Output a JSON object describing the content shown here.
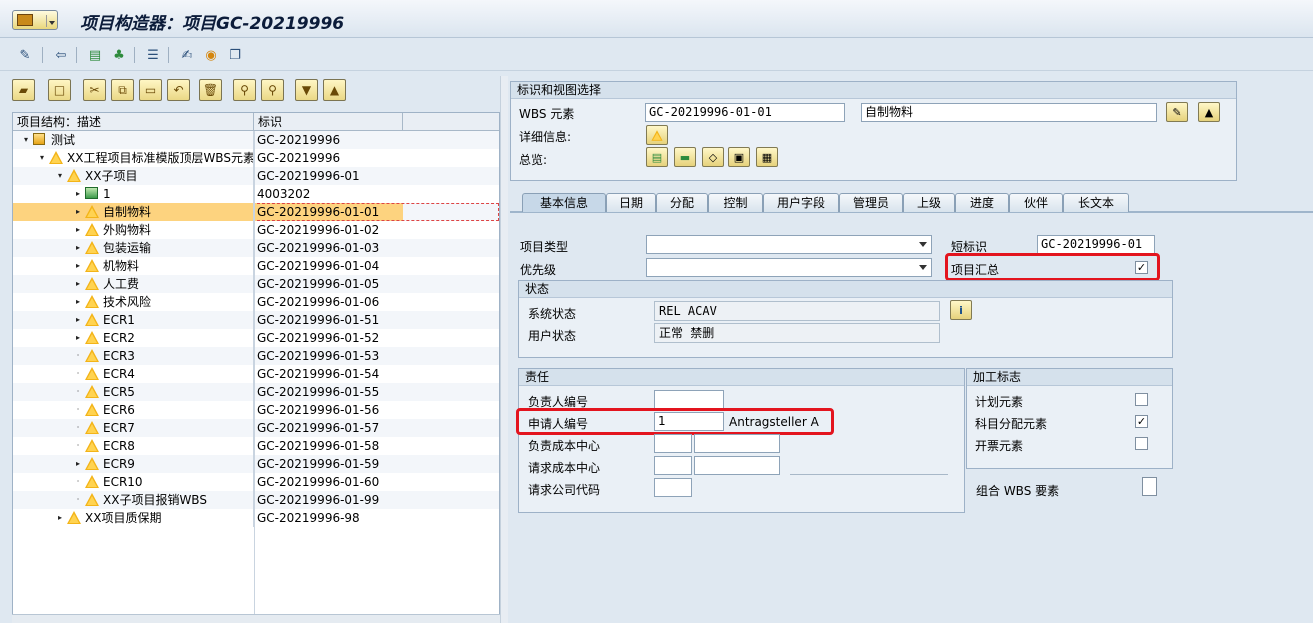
{
  "window": {
    "title": "项目构造器：项目GC-20219996"
  },
  "app_toolbar": {
    "icons": [
      "pencil-glasses-icon",
      "back-nav-icon",
      "green-hierarchy-icon",
      "orange-hierarchy-icon",
      "list-icon",
      "edit-icon",
      "coin-icon",
      "document-settings-icon"
    ]
  },
  "tree_toolbar": {
    "icons": [
      "open-folder-icon",
      "new-doc-icon",
      "cut-icon",
      "copy-icon",
      "paste-icon",
      "undo-icon",
      "delete-icon",
      "find-icon",
      "find-next-icon",
      "expand-icon",
      "collapse-icon"
    ]
  },
  "tree": {
    "headers": {
      "desc": "项目结构：描述",
      "id": "标识"
    },
    "rows": [
      {
        "level": 0,
        "exp": "▾",
        "icon": "project",
        "label": "测试",
        "id": "GC-20219996"
      },
      {
        "level": 1,
        "exp": "▾",
        "icon": "wbs",
        "label": "XX工程项目标准模版顶层WBS元素",
        "id": "GC-20219996"
      },
      {
        "level": 2,
        "exp": "▾",
        "icon": "wbs",
        "label": "XX子项目",
        "id": "GC-20219996-01"
      },
      {
        "level": 3,
        "exp": "▸",
        "icon": "network",
        "label": "1",
        "id": "4003202"
      },
      {
        "level": 3,
        "exp": "▸",
        "icon": "wbs",
        "label": "自制物料",
        "id": "GC-20219996-01-01",
        "selected": true
      },
      {
        "level": 3,
        "exp": "▸",
        "icon": "wbs",
        "label": "外购物料",
        "id": "GC-20219996-01-02"
      },
      {
        "level": 3,
        "exp": "▸",
        "icon": "wbs",
        "label": "包装运输",
        "id": "GC-20219996-01-03"
      },
      {
        "level": 3,
        "exp": "▸",
        "icon": "wbs",
        "label": "机物料",
        "id": "GC-20219996-01-04"
      },
      {
        "level": 3,
        "exp": "▸",
        "icon": "wbs",
        "label": "人工费",
        "id": "GC-20219996-01-05"
      },
      {
        "level": 3,
        "exp": "▸",
        "icon": "wbs",
        "label": "技术风险",
        "id": "GC-20219996-01-06"
      },
      {
        "level": 3,
        "exp": "▸",
        "icon": "wbs",
        "label": "ECR1",
        "id": "GC-20219996-01-51"
      },
      {
        "level": 3,
        "exp": "▸",
        "icon": "wbs",
        "label": "ECR2",
        "id": "GC-20219996-01-52"
      },
      {
        "level": 3,
        "exp": "·",
        "icon": "wbs",
        "label": "ECR3",
        "id": "GC-20219996-01-53"
      },
      {
        "level": 3,
        "exp": "·",
        "icon": "wbs",
        "label": "ECR4",
        "id": "GC-20219996-01-54"
      },
      {
        "level": 3,
        "exp": "·",
        "icon": "wbs",
        "label": "ECR5",
        "id": "GC-20219996-01-55"
      },
      {
        "level": 3,
        "exp": "·",
        "icon": "wbs",
        "label": "ECR6",
        "id": "GC-20219996-01-56"
      },
      {
        "level": 3,
        "exp": "·",
        "icon": "wbs",
        "label": "ECR7",
        "id": "GC-20219996-01-57"
      },
      {
        "level": 3,
        "exp": "·",
        "icon": "wbs",
        "label": "ECR8",
        "id": "GC-20219996-01-58"
      },
      {
        "level": 3,
        "exp": "▸",
        "icon": "wbs",
        "label": "ECR9",
        "id": "GC-20219996-01-59"
      },
      {
        "level": 3,
        "exp": "·",
        "icon": "wbs",
        "label": "ECR10",
        "id": "GC-20219996-01-60"
      },
      {
        "level": 3,
        "exp": "·",
        "icon": "wbs",
        "label": "XX子项目报销WBS",
        "id": "GC-20219996-01-99"
      },
      {
        "level": 2,
        "exp": "▸",
        "icon": "wbs",
        "label": "XX项目质保期",
        "id": "GC-20219996-98"
      }
    ]
  },
  "header_group": {
    "title": "标识和视图选择",
    "wbs_label": "WBS 元素",
    "wbs_value": "GC-20219996-01-01",
    "wbs_desc": "自制物料",
    "detail_label": "详细信息:",
    "overview_label": "总览:"
  },
  "tabs": [
    "基本信息",
    "日期",
    "分配",
    "控制",
    "用户字段",
    "管理员",
    "上级",
    "进度",
    "伙伴",
    "长文本"
  ],
  "basic": {
    "project_type_label": "项目类型",
    "priority_label": "优先级",
    "short_id_label": "短标识",
    "short_id_value": "GC-20219996-01",
    "summary_label": "项目汇总",
    "summary_checked": "✓"
  },
  "status_group": {
    "title": "状态",
    "system_label": "系统状态",
    "system_value": "REL  ACAV",
    "user_label": "用户状态",
    "user_value": "正常   禁删"
  },
  "resp_group": {
    "title": "责任",
    "person_label": "负责人编号",
    "person_value": "",
    "applicant_label": "申请人编号",
    "applicant_value": "1",
    "applicant_name": "Antragsteller A",
    "cost_center_label": "负责成本中心",
    "req_cost_center_label": "请求成本中心",
    "req_company_label": "请求公司代码"
  },
  "proc_group": {
    "title": "加工标志",
    "plan_label": "计划元素",
    "plan_checked": "",
    "acct_label": "科目分配元素",
    "acct_checked": "✓",
    "bill_label": "开票元素",
    "bill_checked": ""
  },
  "combo_label": "组合 WBS 要素",
  "colors": {
    "wbs_icon": "#f3b418",
    "selection": "#fdd37f",
    "highlight_box": "#e3141e"
  }
}
